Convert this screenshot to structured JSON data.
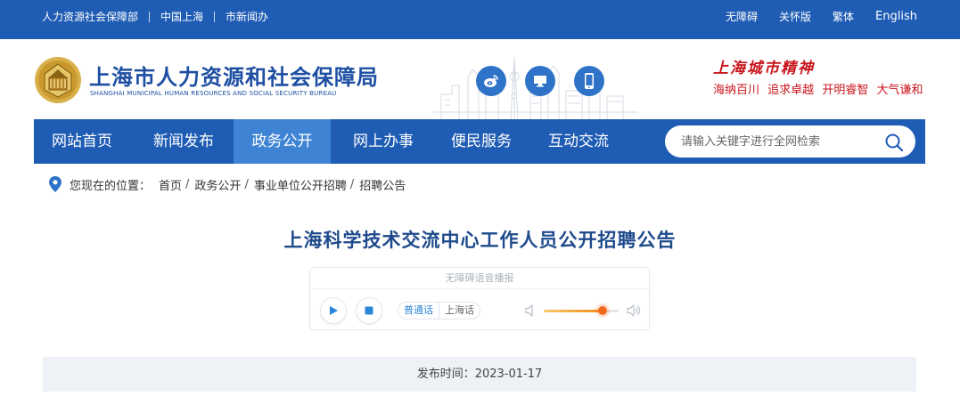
{
  "topbar": {
    "links": [
      "人力资源社会保障部",
      "中国上海",
      "市新闻办"
    ],
    "tools": [
      "无障碍",
      "关怀版",
      "繁体",
      "English"
    ]
  },
  "header": {
    "title": "上海市人力资源和社会保障局",
    "subtitle": "SHANGHAI MUNICIPAL HUMAN RESOURCES AND SOCIAL SECURITY BUREAU",
    "social_icons": [
      "weibo-icon",
      "desktop-icon",
      "mobile-icon"
    ],
    "spirit_title": "上海城市精神",
    "spirit_words": [
      "海纳百川",
      "追求卓越",
      "开明睿智",
      "大气谦和"
    ]
  },
  "nav": {
    "items": [
      "网站首页",
      "新闻发布",
      "政务公开",
      "网上办事",
      "便民服务",
      "互动交流"
    ],
    "active": "政务公开",
    "search_placeholder": "请输入关键字进行全网检索"
  },
  "breadcrumb": {
    "label": "您现在的位置：",
    "items": [
      "首页",
      "政务公开",
      "事业单位公开招聘",
      "招聘公告"
    ]
  },
  "article": {
    "title": "上海科学技术交流中心工作人员公开招聘公告"
  },
  "player": {
    "title": "无障碍语音播报",
    "lang_options": [
      "普通话",
      "上海话"
    ],
    "lang_selected": "普通话",
    "volume": 0.78
  },
  "publish": {
    "text": "发布时间：2023-01-17"
  },
  "colors": {
    "brand_blue": "#1f5cb4",
    "nav_active": "#3f83d4",
    "title_blue": "#1e4a8c",
    "spirit_red": "#c8161d",
    "volume_orange": "#f26a1c"
  }
}
